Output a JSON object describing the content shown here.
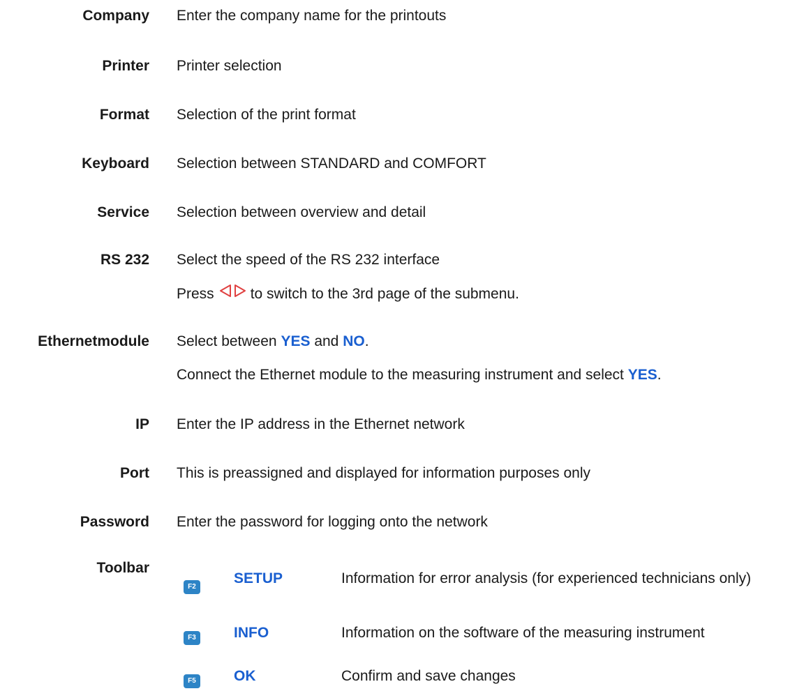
{
  "settings": [
    {
      "term": "Company",
      "desc": "Enter the company name for the printouts"
    },
    {
      "term": "Printer",
      "desc": "Printer selection"
    },
    {
      "term": "Format",
      "desc": "Selection of the print format"
    },
    {
      "term": "Keyboard",
      "desc": "Selection between STANDARD and COMFORT"
    },
    {
      "term": "Service",
      "desc": "Selection between overview and detail"
    },
    {
      "term": "RS 232",
      "desc": "Select the speed of the RS 232 interface"
    }
  ],
  "press_note": {
    "before": "Press",
    "icon": "left-right-arrow-icon",
    "after": "to switch to the 3rd page of the submenu."
  },
  "ethernet": {
    "term": "Ethernetmodule",
    "line1_before": "Select between",
    "yes": "YES",
    "and": "and",
    "no": "NO",
    "period": ".",
    "line2_before": "Connect the Ethernet module to the measuring instrument and select",
    "line2_yes": "YES",
    "line2_period": "."
  },
  "network": [
    {
      "term": "IP",
      "desc": "Enter the IP address in the Ethernet network"
    },
    {
      "term": "Port",
      "desc": "This is preassigned and displayed for information purposes only"
    },
    {
      "term": "Password",
      "desc": "Enter the password for logging onto the network"
    }
  ],
  "toolbar": {
    "term": "Toolbar",
    "items": [
      {
        "key": "F2",
        "label": "SETUP",
        "desc": "Information for error analysis (for experienced technicians only)"
      },
      {
        "key": "F3",
        "label": "INFO",
        "desc": "Information on the software of the measuring instrument"
      },
      {
        "key": "F5",
        "label": "OK",
        "desc": "Confirm and save changes"
      }
    ]
  },
  "colors": {
    "text": "#1a1a1a",
    "accent": "#1a5fd0",
    "key_badge": "#2d84c6",
    "arrow": "#e04040"
  }
}
